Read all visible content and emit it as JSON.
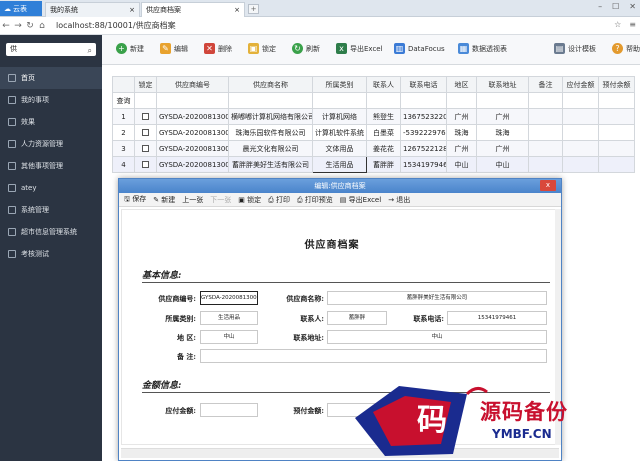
{
  "browser": {
    "cloud_label": "云表",
    "tabs": [
      "我的系统",
      "供应商档案"
    ],
    "url": "localhost:88/10001/供应商档案"
  },
  "sidebar": {
    "search_value": "供",
    "items": [
      {
        "label": "首页",
        "active": true
      },
      {
        "label": "我的事项"
      },
      {
        "label": "效果"
      },
      {
        "label": "人力资源管理"
      },
      {
        "label": "其他事项管理"
      },
      {
        "label": "atey"
      },
      {
        "label": "系统管理"
      },
      {
        "label": "超市信息管理系统"
      },
      {
        "label": "考核测试"
      }
    ]
  },
  "toolbar": {
    "new": "新建",
    "edit": "编辑",
    "delete": "删除",
    "lock": "锁定",
    "refresh": "刷新",
    "export": "导出Excel",
    "datafocus": "DataFocus",
    "pivot": "数据透视表",
    "design": "设计模板",
    "help": "帮助"
  },
  "grid": {
    "headers": [
      "",
      "锁定",
      "供应商编号",
      "供应商名称",
      "所属类别",
      "联系人",
      "联系电话",
      "地区",
      "联系地址",
      "备注",
      "应付金额",
      "预付余额"
    ],
    "query_label": "查询",
    "rows": [
      {
        "no": "1",
        "code": "GYSDA-20200813004",
        "name": "横嘟嘟计算机网络有限公司",
        "category": "计算机网络",
        "contact": "熊登生",
        "phone": "13675232206",
        "region": "广州",
        "address": "广州"
      },
      {
        "no": "2",
        "code": "GYSDA-20200813001",
        "name": "珠海乐园软件有限公司",
        "category": "计算机软件系统",
        "contact": "白墨菜",
        "phone": "-539222976",
        "region": "珠海",
        "address": "珠海"
      },
      {
        "no": "3",
        "code": "GYSDA-20200813002",
        "name": "晨光文化有限公司",
        "category": "文体用品",
        "contact": "姜花花",
        "phone": "12675221289",
        "region": "广州",
        "address": "广州"
      },
      {
        "no": "4",
        "code": "GYSDA-20200813003",
        "name": "蓄胖胖美好生活有限公司",
        "category": "生活用品",
        "contact": "蓄胖胖",
        "phone": "15341979461",
        "region": "中山",
        "address": "中山"
      }
    ]
  },
  "modal": {
    "title": "编辑:供应商档案",
    "close": "x",
    "tools": [
      "保存",
      "新建",
      "上一张",
      "下一张",
      "锁定",
      "打印",
      "打印预览",
      "导出Excel",
      "退出"
    ],
    "doc_title": "供应商档案",
    "basic_section": "基本信息:",
    "amount_section": "金额信息:",
    "labels": {
      "code": "供应商编号:",
      "name": "供应商名称:",
      "category": "所属类别:",
      "contact": "联系人:",
      "phone": "联系电话:",
      "region": "地    区:",
      "address": "联系地址:",
      "remark": "备    注:",
      "payable": "应付金额:",
      "prepaid": "预付金额:"
    },
    "values": {
      "code": "GYSDA-20200813003",
      "name": "蓄胖胖美好生活有限公司",
      "category": "生活用品",
      "contact": "蓄胖胖",
      "phone": "15341979461",
      "region": "中山",
      "address": "中山"
    }
  },
  "watermark": {
    "glyph": "码",
    "text": "源码备份",
    "sub": "YMBF.CN",
    "colors": {
      "red": "#c8102e",
      "blue": "#1a2b8f"
    }
  }
}
